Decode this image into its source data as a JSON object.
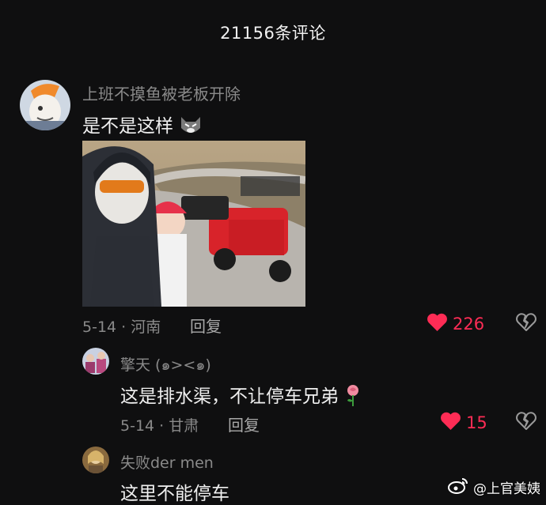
{
  "header": {
    "title": "21156条评论"
  },
  "comments": [
    {
      "username": "上班不摸鱼被老板开除",
      "text": "是不是这样",
      "emoji": "cat-face-emoji",
      "date_location": "5-14 · 河南",
      "reply_label": "回复",
      "likes": "226"
    },
    {
      "username": "擎天 (๑><๑)",
      "text": "这是排水渠，不让停车兄弟",
      "emoji": "rose-emoji",
      "date_location": "5-14 · 甘肃",
      "reply_label": "回复",
      "likes": "15"
    },
    {
      "username": "失败der men",
      "text": "这里不能停车"
    }
  ],
  "watermark": {
    "text": "@上官美姨"
  },
  "colors": {
    "like": "#fe2c55",
    "background": "#0f0f10"
  }
}
